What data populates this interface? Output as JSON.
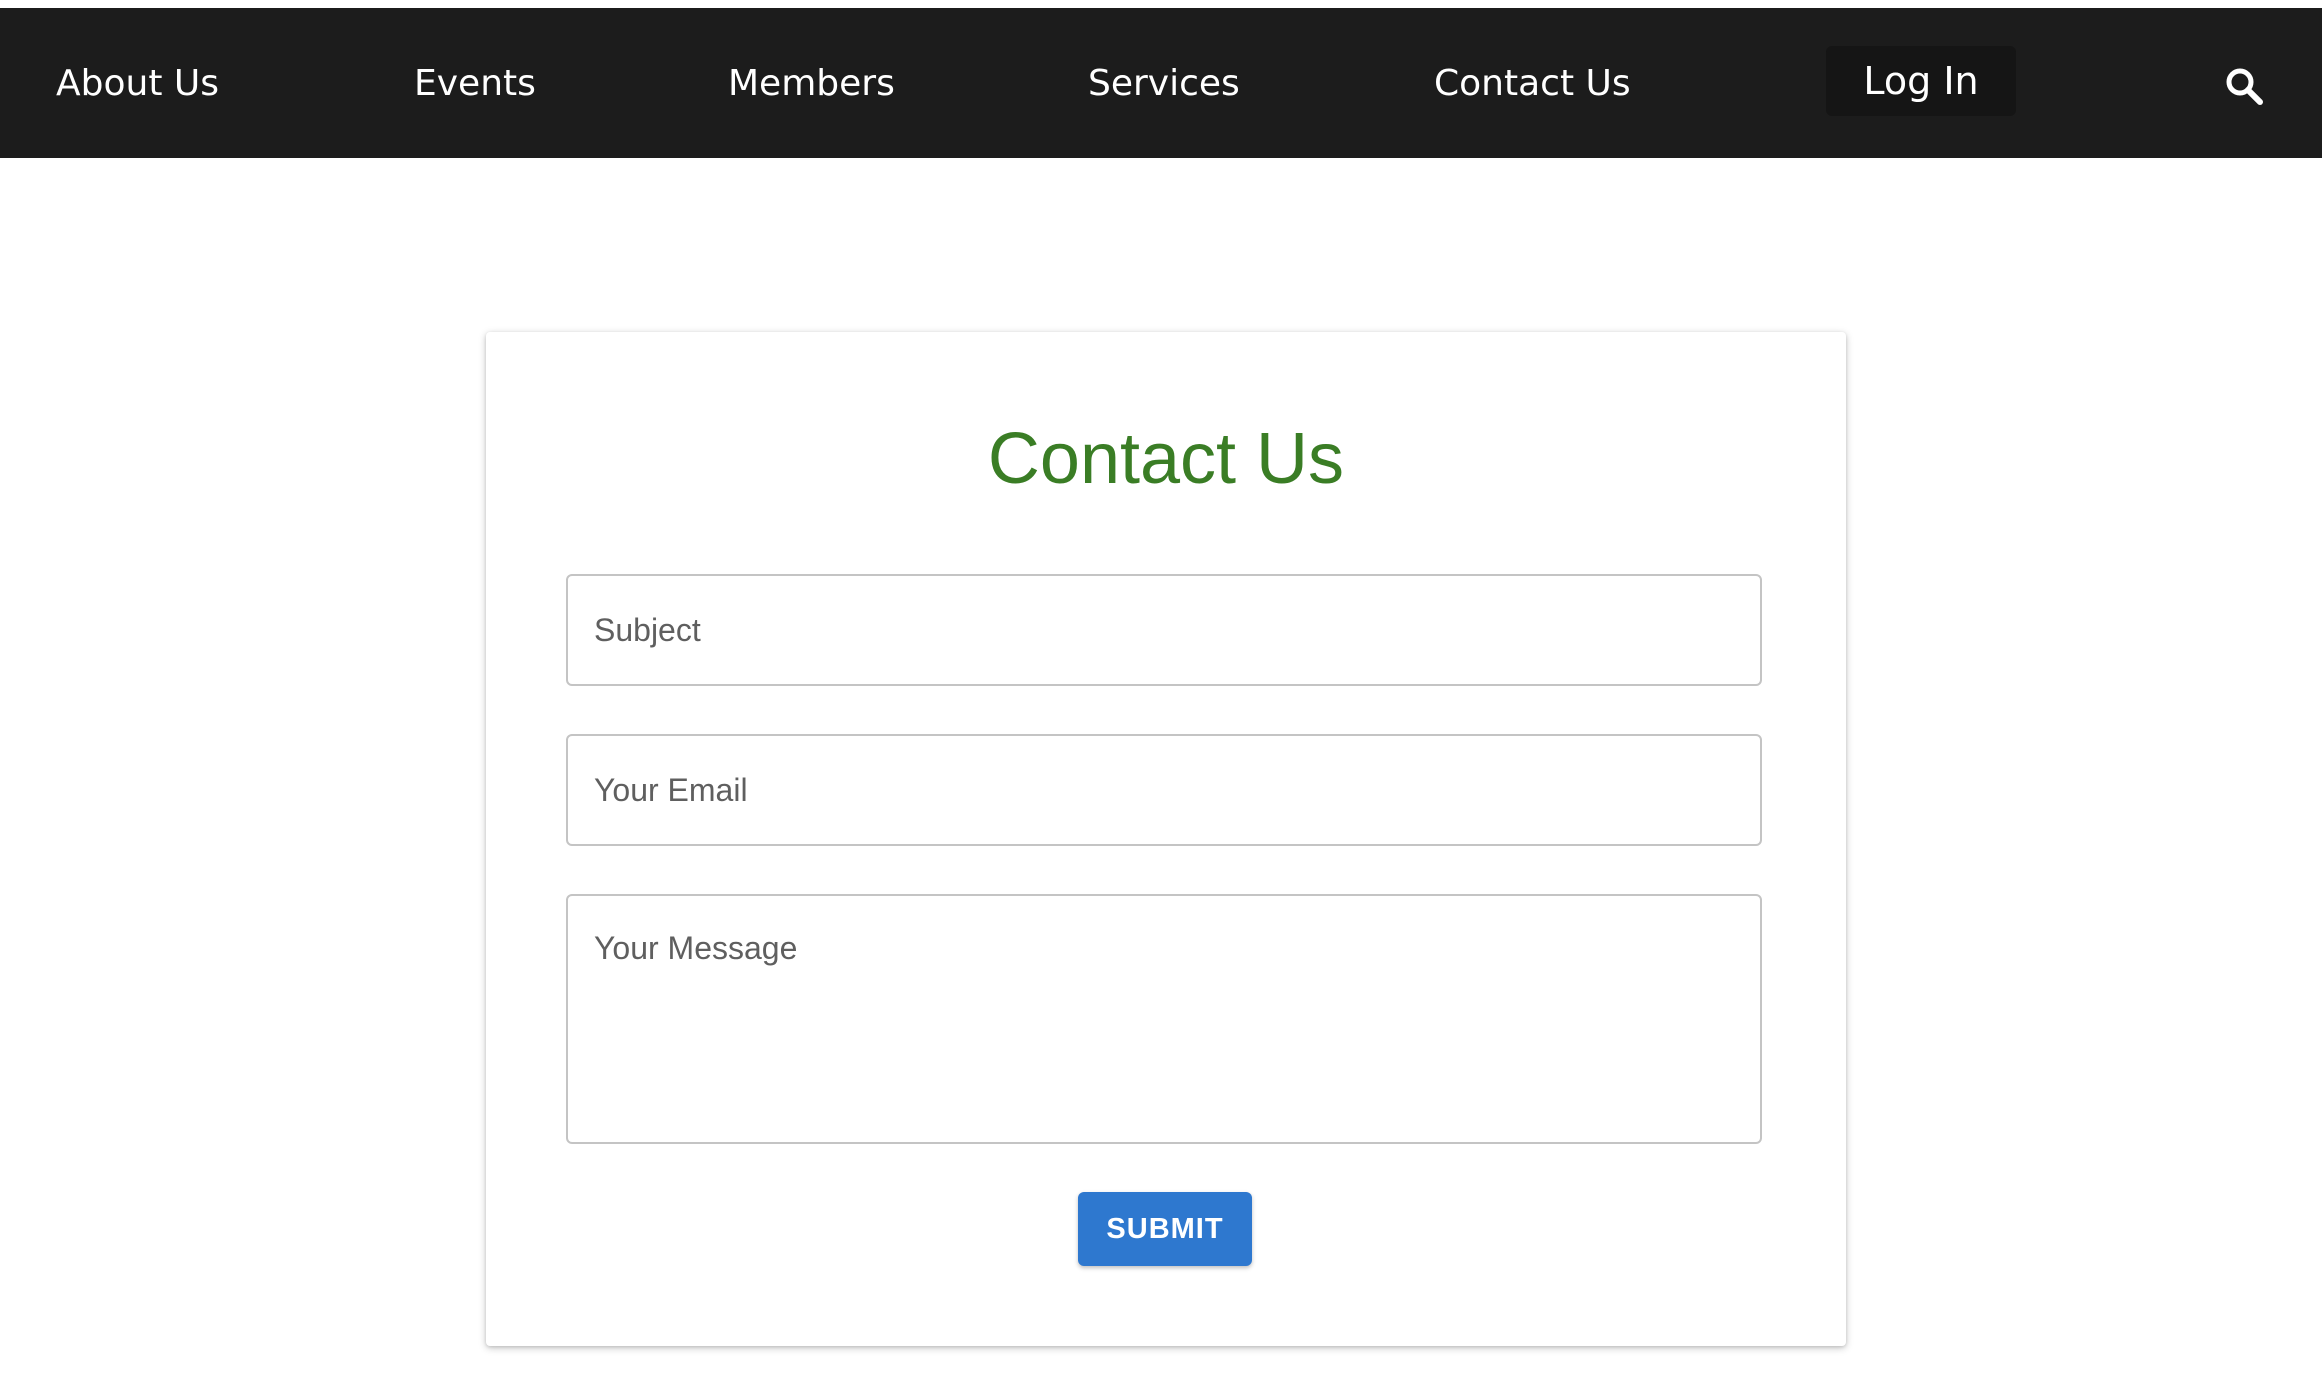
{
  "nav": {
    "items": [
      {
        "label": "About Us"
      },
      {
        "label": "Events"
      },
      {
        "label": "Members"
      },
      {
        "label": "Services"
      },
      {
        "label": "Contact Us"
      }
    ],
    "login_label": "Log In",
    "search_icon": "search-icon"
  },
  "form": {
    "title": "Contact Us",
    "subject_label": "Subject",
    "email_label": "Your Email",
    "message_label": "Your Message",
    "submit_label": "SUBMIT"
  },
  "colors": {
    "navbar_bg": "#1c1c1c",
    "title_green": "#3a7d25",
    "submit_blue": "#2e78cf"
  }
}
